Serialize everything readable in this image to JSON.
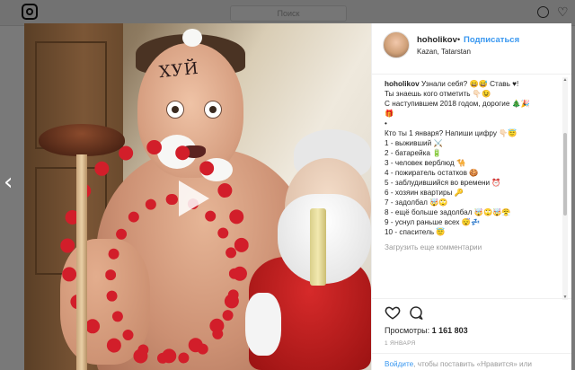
{
  "background": {
    "search_placeholder": "Поиск"
  },
  "navigation": {
    "prev_glyph": "‹",
    "next_glyph": "›"
  },
  "media": {
    "forehead_text": "ХУЙ"
  },
  "post": {
    "username": "hoholikov",
    "separator": "•",
    "follow_label": "Подписаться",
    "location": "Kazan, Tatarstan",
    "caption_lines": [
      "Узнали себя? 😄😅 Ставь ♥!",
      "Ты знаешь кого отметить 👇🏻😉",
      "С наступившем 2018 годом, дорогие 🎄🎉",
      "🎁",
      "•",
      "Кто ты 1 января? Напиши цифру 👇🏻😇",
      "1 - выживший ⚔️",
      "2 - батарейка 🔋",
      "3 - человек верблюд 🐪",
      "4 - пожиратель остатков 🍪",
      "5 - заблудившийся во времени ⏰",
      "6 - хозяин квартиры 🔑",
      "7 - задолбал 🤯🙄",
      "8 - ещё больше задолбал 🤯🙄🤯😤",
      "9 - уснул раньше всех 😴💤",
      "10 - спаситель 😇"
    ],
    "load_more_label": "Загрузить еще комментарии",
    "views_label": "Просмотры:",
    "views_count": "1 161 803",
    "date": "1 ЯНВАРЯ",
    "login_link": "Войдите",
    "login_text": ", чтобы поставить «Нравится» или прокомментировать."
  },
  "colors": {
    "accent": "#3897f0",
    "text": "#262626",
    "muted": "#999999"
  },
  "icons": {
    "logo": "instagram-logo-icon",
    "explore": "compass-icon",
    "activity": "heart-icon",
    "like": "heart-outline-icon",
    "comment": "comment-bubble-icon",
    "play": "play-icon"
  }
}
